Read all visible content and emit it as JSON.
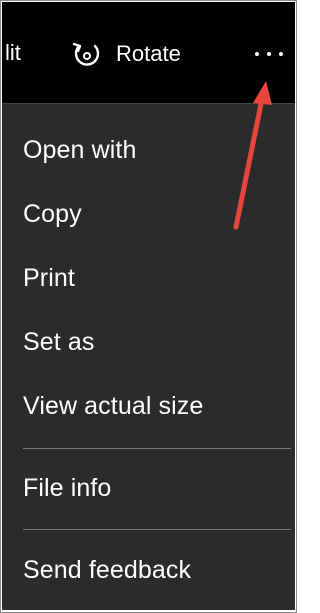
{
  "toolbar": {
    "edit_label_fragment": "lit",
    "rotate_label": "Rotate",
    "rotate_icon": "rotate-icon",
    "more_icon": "more-horizontal-icon"
  },
  "menu": {
    "items": [
      {
        "label": "Open with"
      },
      {
        "label": "Copy"
      },
      {
        "label": "Print"
      },
      {
        "label": "Set as"
      },
      {
        "label": "View actual size"
      },
      {
        "label": "File info"
      },
      {
        "label": "Send feedback"
      }
    ]
  },
  "annotation": {
    "arrow_color": "#e8453c"
  },
  "colors": {
    "toolbar_bg": "#000000",
    "menu_bg": "#2b2b2b",
    "text": "#ffffff",
    "separator": "#7a7a7a"
  }
}
